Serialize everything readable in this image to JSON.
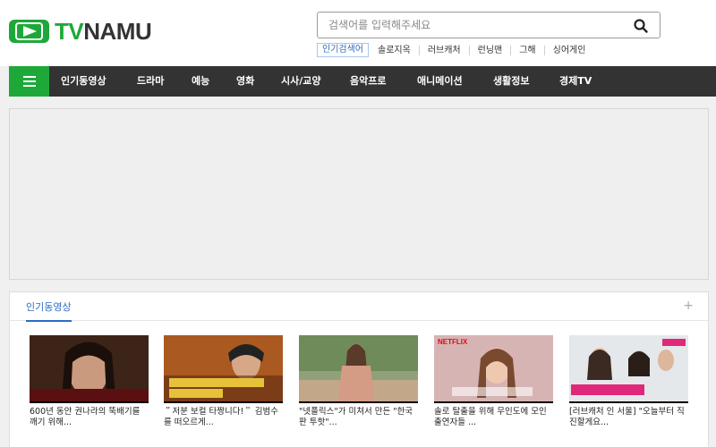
{
  "logo": {
    "tv": "TV",
    "namu": "NAMU"
  },
  "search": {
    "placeholder": "검색어를 입력해주세요"
  },
  "keywords": {
    "label": "인기검색어",
    "items": [
      "솔로지옥",
      "러브캐처",
      "런닝맨",
      "그해",
      "싱어게인"
    ]
  },
  "nav": {
    "items": [
      "인기동영상",
      "드라마",
      "예능",
      "영화",
      "시사/교양",
      "음악프로",
      "애니메이션",
      "생활정보",
      "경제TV"
    ]
  },
  "section": {
    "title": "인기동영상",
    "more": "+",
    "videos": [
      {
        "caption": "600년 동안 권나라의 뚝배기를 깨기 위해...",
        "thumb_text": ""
      },
      {
        "caption": "＂저분 보컬 타짱니다!＂ 김범수를 떠오르게...",
        "thumb_text": "보컬 타짱 들잘 가왕의 하관 오르할래"
      },
      {
        "caption": "\"넷플릭스\"가 미쳐서 만든 \"한국판 투핫\"...",
        "thumb_text": ""
      },
      {
        "caption": "솔로 탈출을 위해 무인도에 모인 출연자들 ...",
        "thumb_text": "시작 없어요"
      },
      {
        "caption": "[러브캐처 인 서울] \"오늘부터 직진할게요...",
        "thumb_text": "저랑 놀러 갈래요?"
      }
    ]
  },
  "colors": {
    "brand_green": "#1fa83a",
    "nav_bg": "#333333",
    "link_blue": "#2d6cc4"
  }
}
